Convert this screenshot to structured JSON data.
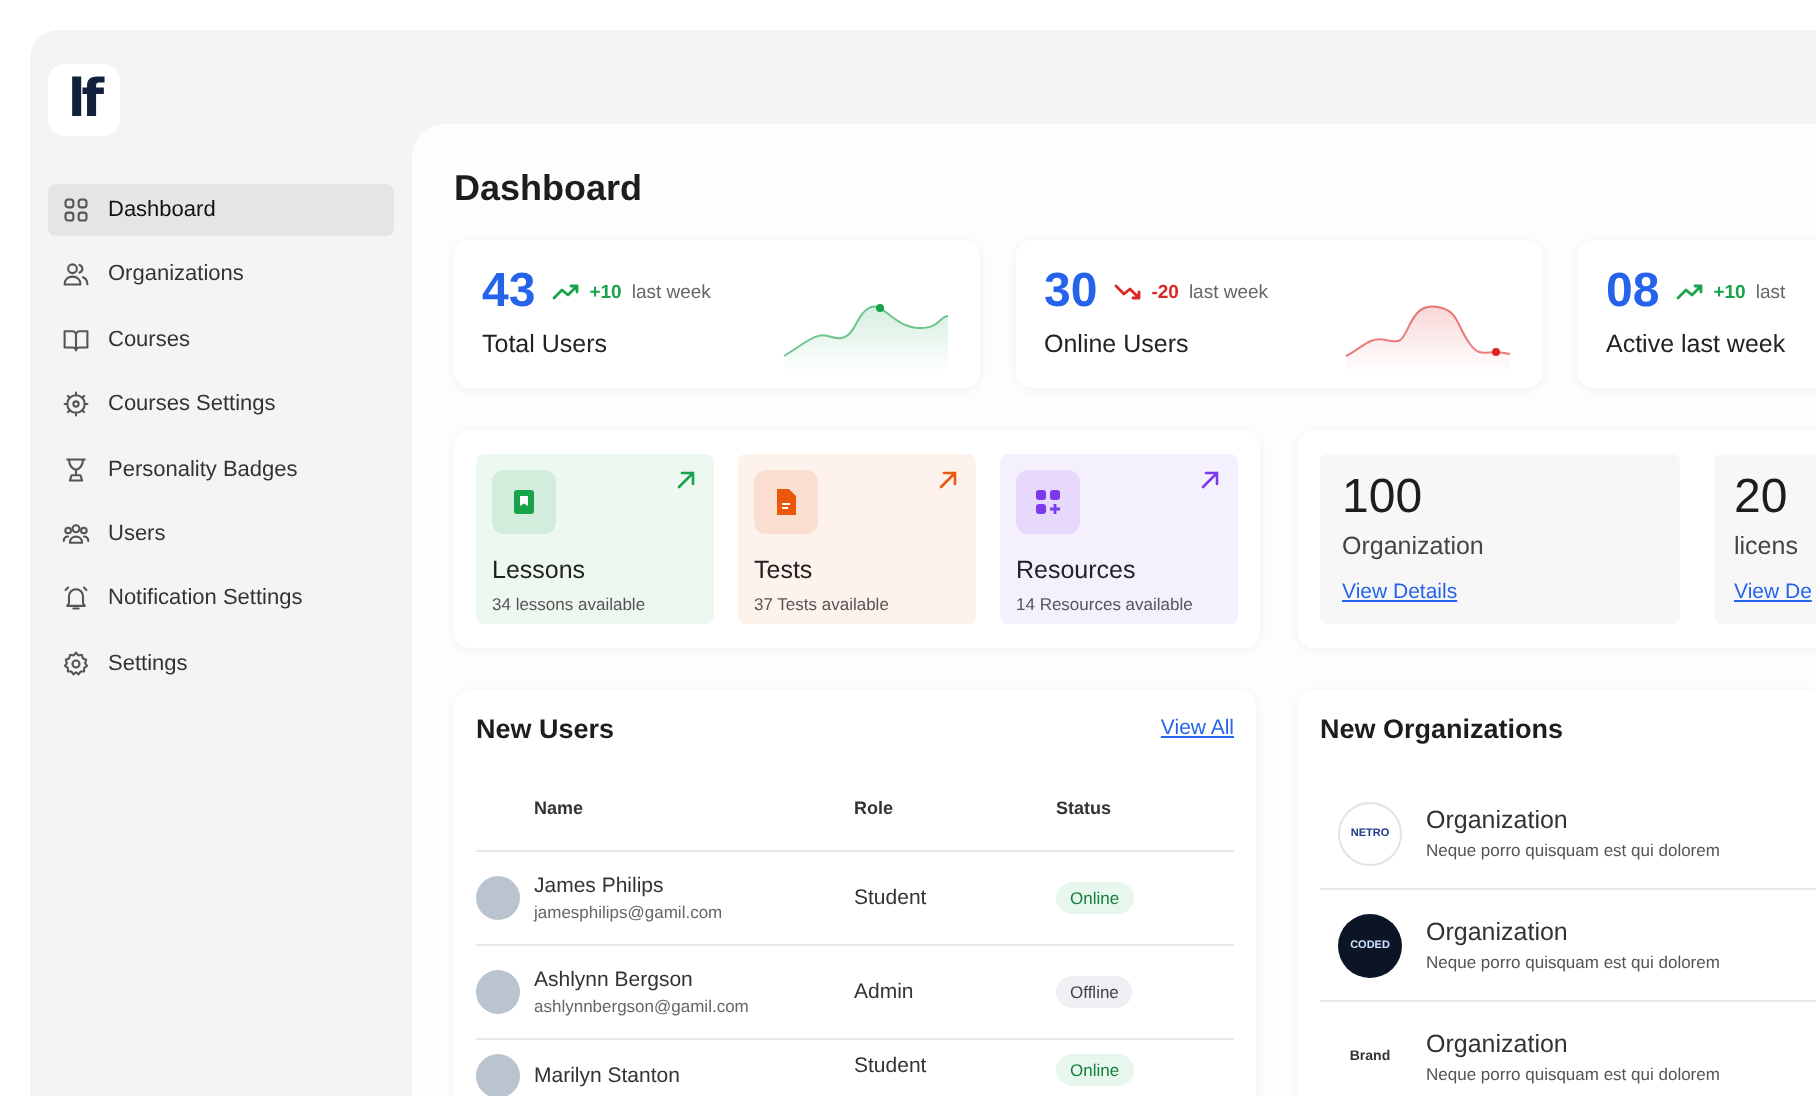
{
  "logo": {
    "text": "lf"
  },
  "sidebar": {
    "items": [
      {
        "label": "Dashboard",
        "selected": true
      },
      {
        "label": "Organizations",
        "selected": false
      },
      {
        "label": "Courses",
        "selected": false
      },
      {
        "label": "Courses Settings",
        "selected": false
      },
      {
        "label": "Personality Badges",
        "selected": false
      },
      {
        "label": "Users",
        "selected": false
      },
      {
        "label": "Notification Settings",
        "selected": false
      },
      {
        "label": "Settings",
        "selected": false
      }
    ]
  },
  "page_title": "Dashboard",
  "stats": [
    {
      "value": "43",
      "rising": true,
      "change": "+10",
      "period": "last week",
      "label": "Total Users",
      "sparkline": true
    },
    {
      "value": "30",
      "rising": false,
      "change": "-20",
      "period": "last week",
      "label": "Online Users",
      "sparkline": true
    },
    {
      "value": "08",
      "rising": true,
      "change": "+10",
      "period": "last",
      "label": "Active last week",
      "sparkline": false
    }
  ],
  "resources": [
    {
      "title": "Lessons",
      "subtitle": "34 lessons available",
      "color": "#16a34a"
    },
    {
      "title": "Tests",
      "subtitle": "37 Tests available",
      "color": "#ea580c"
    },
    {
      "title": "Resources",
      "subtitle": "14 Resources available",
      "color": "#7c3aed"
    }
  ],
  "summaries": [
    {
      "value": "100",
      "label": "Organization",
      "link": "View Details"
    },
    {
      "value": "20",
      "label": "licens",
      "link": "View De"
    }
  ],
  "new_users": {
    "title": "New Users",
    "link": "View All",
    "columns": [
      "Name",
      "Role",
      "Status"
    ],
    "rows": [
      {
        "name": "James Philips",
        "email": "jamesphilips@gamil.com",
        "role": "Student",
        "status": "Online",
        "online": true
      },
      {
        "name": "Ashlynn Bergson",
        "email": "ashlynnbergson@gamil.com",
        "role": "Admin",
        "status": "Offline",
        "online": false
      },
      {
        "name": "Marilyn Stanton",
        "role": "Student",
        "status": "Online",
        "online": true
      }
    ]
  },
  "new_organizations": {
    "title": "New Organizations",
    "items": [
      {
        "logo_text": "NETRO",
        "kind": "light",
        "name": "Organization",
        "description": "Neque porro quisquam est qui dolorem"
      },
      {
        "logo_text": "CODED",
        "kind": "dark",
        "name": "Organization",
        "description": "Neque porro quisquam est qui dolorem"
      },
      {
        "logo_text": "Brand",
        "kind": "plain",
        "name": "Organization",
        "description": "Neque porro quisquam est qui dolorem"
      }
    ]
  }
}
